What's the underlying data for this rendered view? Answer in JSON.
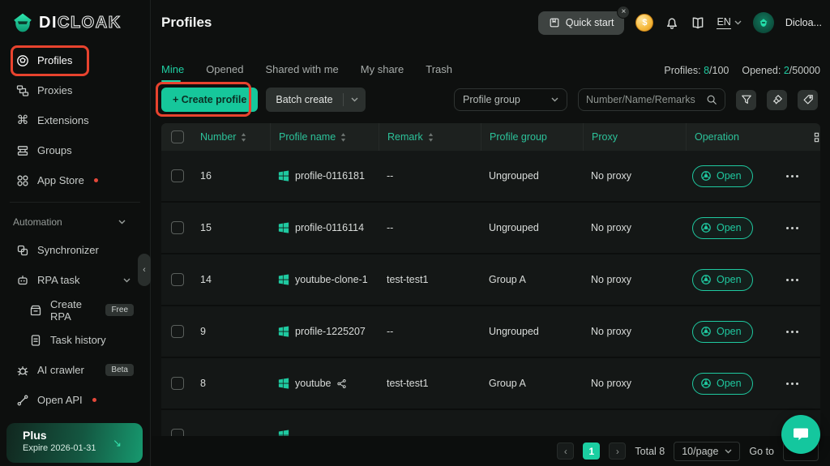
{
  "brand": {
    "solid": "DI",
    "outline": "CLOAK"
  },
  "sidebar": {
    "items": [
      {
        "label": "Profiles"
      },
      {
        "label": "Proxies"
      },
      {
        "label": "Extensions"
      },
      {
        "label": "Groups"
      },
      {
        "label": "App Store"
      }
    ],
    "automation": {
      "label": "Automation",
      "items": [
        {
          "label": "Synchronizer"
        },
        {
          "label": "RPA task"
        },
        {
          "label": "Create RPA",
          "badge": "Free"
        },
        {
          "label": "Task history"
        },
        {
          "label": "AI crawler",
          "badge": "Beta"
        },
        {
          "label": "Open API"
        }
      ]
    },
    "plan": {
      "title": "Plus",
      "expire": "Expire 2026-01-31"
    }
  },
  "topbar": {
    "title": "Profiles",
    "quick_start": "Quick start",
    "language": "EN",
    "username": "Dicloa..."
  },
  "tabs": {
    "items": [
      "Mine",
      "Opened",
      "Shared with me",
      "My share",
      "Trash"
    ]
  },
  "stats": {
    "profiles_label": "Profiles:",
    "profiles_value": "8",
    "profiles_total": "/100",
    "opened_label": "Opened:",
    "opened_value": "2",
    "opened_total": "/50000"
  },
  "toolbar": {
    "create_label": "+ Create profile",
    "batch_label": "Batch create",
    "group_filter": "Profile group",
    "search_placeholder": "Number/Name/Remarks"
  },
  "table": {
    "headers": {
      "number": "Number",
      "name": "Profile name",
      "remark": "Remark",
      "group": "Profile group",
      "proxy": "Proxy",
      "operation": "Operation"
    },
    "open_label": "Open",
    "rows": [
      {
        "number": "16",
        "name": "profile-0116181",
        "remark": "--",
        "group": "Ungrouped",
        "proxy": "No proxy"
      },
      {
        "number": "15",
        "name": "profile-0116114",
        "remark": "--",
        "group": "Ungrouped",
        "proxy": "No proxy"
      },
      {
        "number": "14",
        "name": "youtube-clone-1",
        "remark": "test-test1",
        "group": "Group A",
        "proxy": "No proxy"
      },
      {
        "number": "9",
        "name": "profile-1225207",
        "remark": "--",
        "group": "Ungrouped",
        "proxy": "No proxy"
      },
      {
        "number": "8",
        "name": "youtube",
        "remark": "test-test1",
        "group": "Group A",
        "proxy": "No proxy"
      }
    ]
  },
  "pagination": {
    "page": "1",
    "total": "Total 8",
    "per_page": "10/page",
    "goto_label": "Go to"
  },
  "colors": {
    "accent": "#1fc9a0",
    "annotation": "#e8432e"
  }
}
